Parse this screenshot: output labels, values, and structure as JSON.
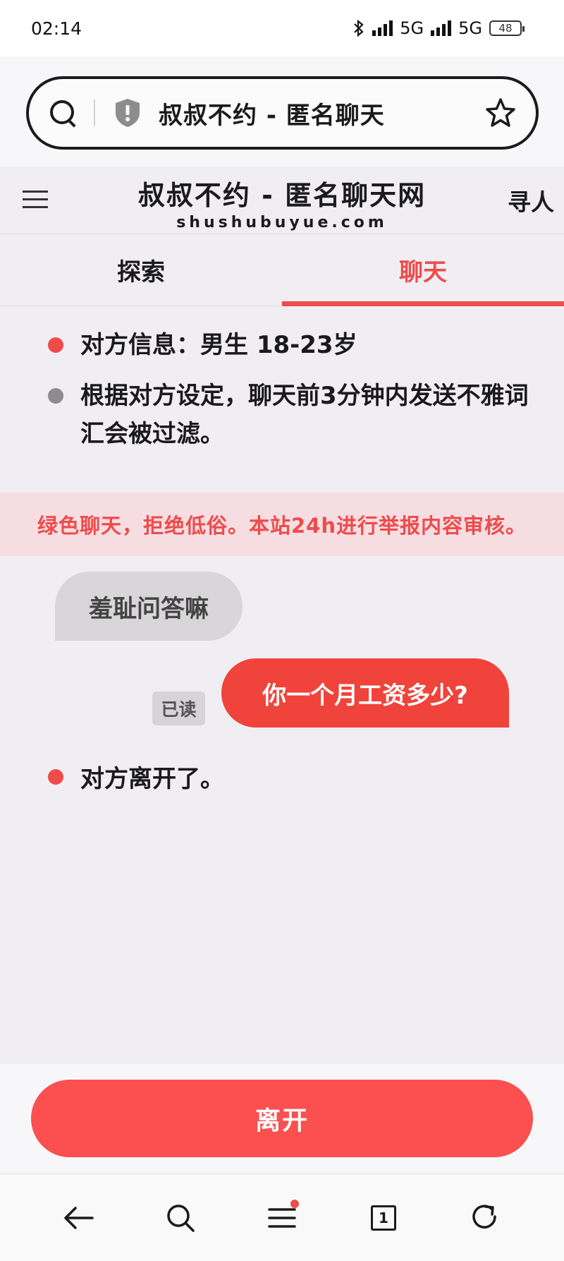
{
  "status_bar": {
    "time": "02:14",
    "network_1": "5G",
    "network_2": "5G",
    "battery": "48",
    "icons": [
      "bluetooth-icon",
      "signal-icon",
      "signal-icon",
      "battery-icon"
    ]
  },
  "address_bar": {
    "title": "叔叔不约 - 匿名聊天",
    "icons": [
      "search-icon",
      "shield-icon",
      "star-icon"
    ]
  },
  "site_header": {
    "title": "叔叔不约 - 匿名聊天网",
    "domain": "shushubuyue.com",
    "find_link": "寻人",
    "icons": [
      "menu-icon"
    ]
  },
  "tabs": [
    {
      "label": "探索",
      "active": false
    },
    {
      "label": "聊天",
      "active": true
    }
  ],
  "info": {
    "partner_info": "对方信息：男生 18-23岁",
    "filter_notice": "根据对方设定，聊天前3分钟内发送不雅词汇会被过滤。"
  },
  "notice": "绿色聊天，拒绝低俗。本站24h进行举报内容审核。",
  "messages": [
    {
      "direction": "incoming",
      "text": "羞耻问答嘛"
    },
    {
      "direction": "outgoing",
      "text": "你一个月工资多少?",
      "read_label": "已读"
    }
  ],
  "left_notice": "对方离开了。",
  "leave_button": "离开",
  "bottom_nav": {
    "tab_count": "1",
    "icons": [
      "back-arrow-icon",
      "search-icon",
      "menu-icon",
      "tabs-icon",
      "refresh-icon"
    ]
  },
  "colors": {
    "accent": "#ef4b4b",
    "leave_button": "#fb4f50",
    "outgoing_bubble": "#f0433b",
    "incoming_bubble": "#d8d6d8",
    "notice_bg": "#f6dde2",
    "page_bg": "#f1eef3"
  }
}
